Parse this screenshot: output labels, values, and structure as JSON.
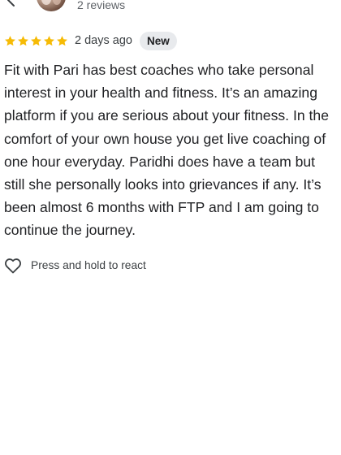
{
  "header": {
    "reviews_count": "2 reviews",
    "back_icon": "chevron-left-icon",
    "avatar_icon": "avatar"
  },
  "review": {
    "rating": 5,
    "max_rating": 5,
    "star_color": "#F6BB06",
    "date": "2 days ago",
    "badge": "New",
    "text": "Fit with Pari has best coaches who take personal interest in your health and fitness. It’s an amazing platform if you are serious about your fitness. In the comfort of your own house you get live coaching of one hour everyday. Paridhi does have a team but still she personally looks into grievances if any. It’s been almost 6 months with FTP and I am going to continue the journey."
  },
  "react": {
    "icon": "heart-outline-icon",
    "label": "Press and hold to react"
  }
}
